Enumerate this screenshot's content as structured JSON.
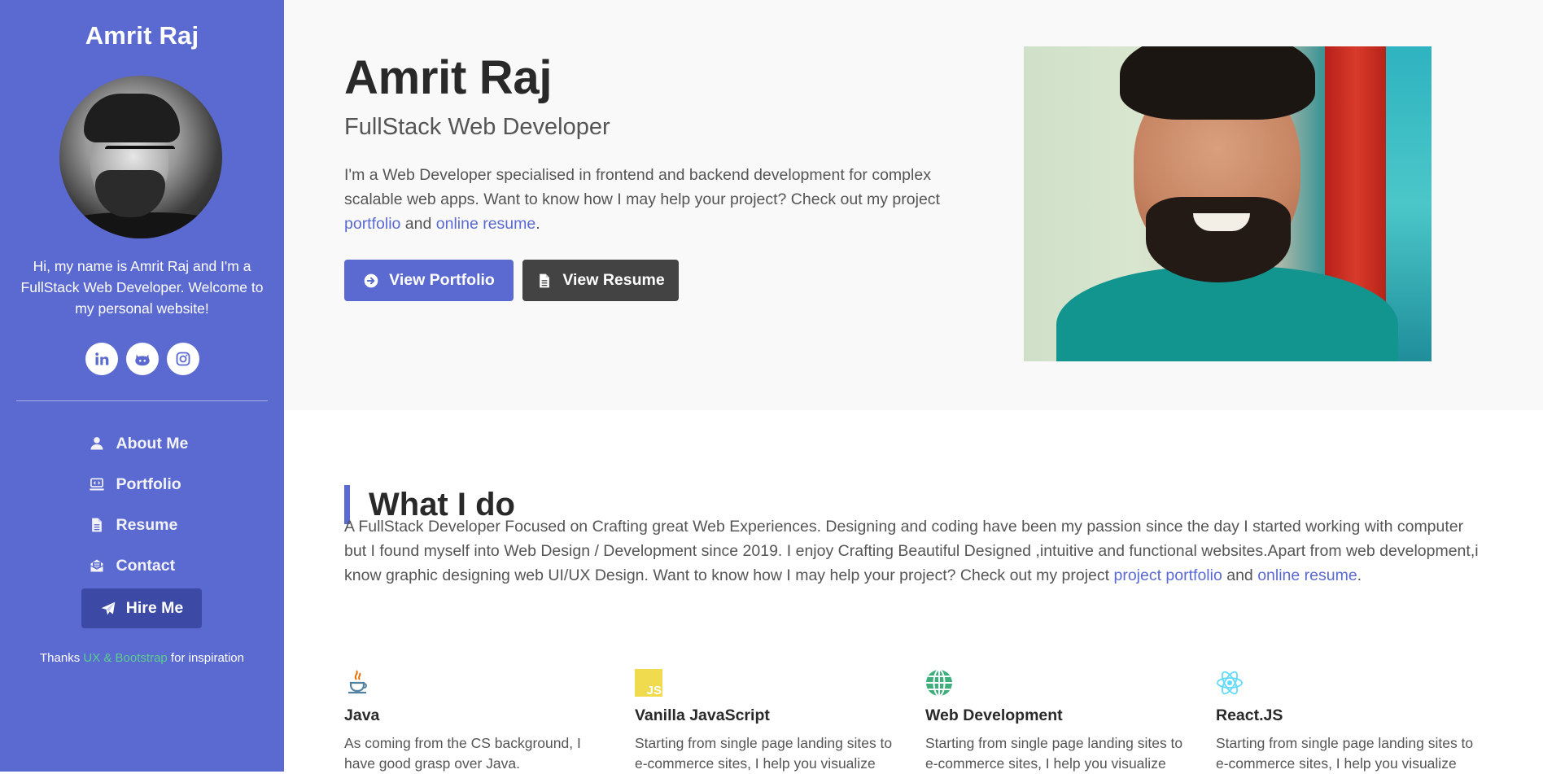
{
  "sidebar": {
    "name": "Amrit Raj",
    "intro": "Hi, my name is Amrit Raj and I'm a FullStack Web Developer. Welcome to my personal website!",
    "socials": [
      "linkedin-icon",
      "github-icon",
      "instagram-icon"
    ],
    "nav": [
      {
        "label": "About Me",
        "icon": "user-icon"
      },
      {
        "label": "Portfolio",
        "icon": "laptop-code-icon"
      },
      {
        "label": "Resume",
        "icon": "file-icon"
      },
      {
        "label": "Contact",
        "icon": "envelope-open-icon"
      }
    ],
    "hire_label": "Hire Me",
    "thanks_prefix": "Thanks ",
    "thanks_link": "UX & Bootstrap",
    "thanks_suffix": " for inspiration",
    "accent": "#5b6ad0"
  },
  "hero": {
    "name": "Amrit Raj",
    "subtitle": "FullStack Web Developer",
    "desc_text": "I'm a Web Developer specialised in frontend and backend development for complex scalable web apps. Want to know how I may help your project? Check out my project ",
    "desc_link1": "portfolio",
    "desc_and": " and ",
    "desc_link2": "online resume",
    "desc_end": ".",
    "btn_portfolio": "View Portfolio",
    "btn_resume": "View Resume"
  },
  "whatido": {
    "heading": "What I do",
    "text": "A FullStack Developer Focused on Crafting great Web Experiences. Designing and coding have been my passion since the day I started working with computer but I found myself into Web Design / Development since 2019. I enjoy Crafting Beautiful Designed ,intuitive and functional websites.Apart from web development,i know graphic designing web UI/UX Design. Want to know how I may help your project? Check out my project ",
    "link1": "project portfolio",
    "and": " and ",
    "link2": "online resume",
    "end": "."
  },
  "skills": [
    {
      "title": "Java",
      "icon": "java-icon",
      "text": "As coming from the CS background, I have good grasp over Java."
    },
    {
      "title": "Vanilla JavaScript",
      "icon": "javascript-icon",
      "text": "Starting from single page landing sites to e-commerce sites, I help you visualize"
    },
    {
      "title": "Web Development",
      "icon": "globe-icon",
      "text": "Starting from single page landing sites to e-commerce sites, I help you visualize"
    },
    {
      "title": "React.JS",
      "icon": "react-icon",
      "text": "Starting from single page landing sites to e-commerce sites, I help you visualize"
    }
  ]
}
